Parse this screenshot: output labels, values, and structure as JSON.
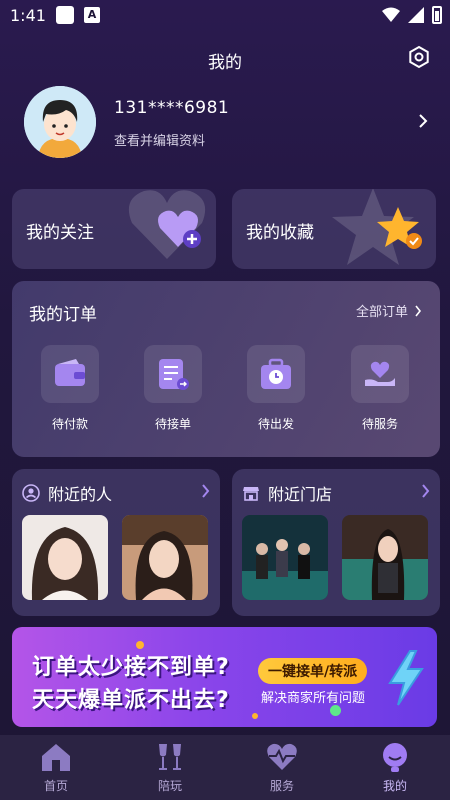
{
  "status_bar": {
    "time": "1:41"
  },
  "header": {
    "title": "我的"
  },
  "profile": {
    "phone": "131****6981",
    "edit_link": "查看并编辑资料"
  },
  "favorites": {
    "follow_label": "我的关注",
    "collect_label": "我的收藏"
  },
  "orders": {
    "title": "我的订单",
    "all_label": "全部订单",
    "items": [
      {
        "label": "待付款",
        "icon": "wallet-icon"
      },
      {
        "label": "待接单",
        "icon": "order-list-icon"
      },
      {
        "label": "待出发",
        "icon": "suitcase-clock-icon"
      },
      {
        "label": "待服务",
        "icon": "heart-hand-icon"
      }
    ]
  },
  "nearby": {
    "people_title": "附近的人",
    "stores_title": "附近门店"
  },
  "banner": {
    "line1": "订单太少接不到单?",
    "line2": "天天爆单派不出去?",
    "pill": "一键接单/转派",
    "subtitle": "解决商家所有问题"
  },
  "tabbar": {
    "items": [
      {
        "label": "首页",
        "icon": "home-icon"
      },
      {
        "label": "陪玩",
        "icon": "cheers-icon"
      },
      {
        "label": "服务",
        "icon": "heartbeat-icon"
      },
      {
        "label": "我的",
        "icon": "profile-icon"
      }
    ],
    "active": "我的"
  },
  "colors": {
    "accent": "#8a6cf0",
    "banner_pill": "#ffb623",
    "background": "#21173e"
  }
}
